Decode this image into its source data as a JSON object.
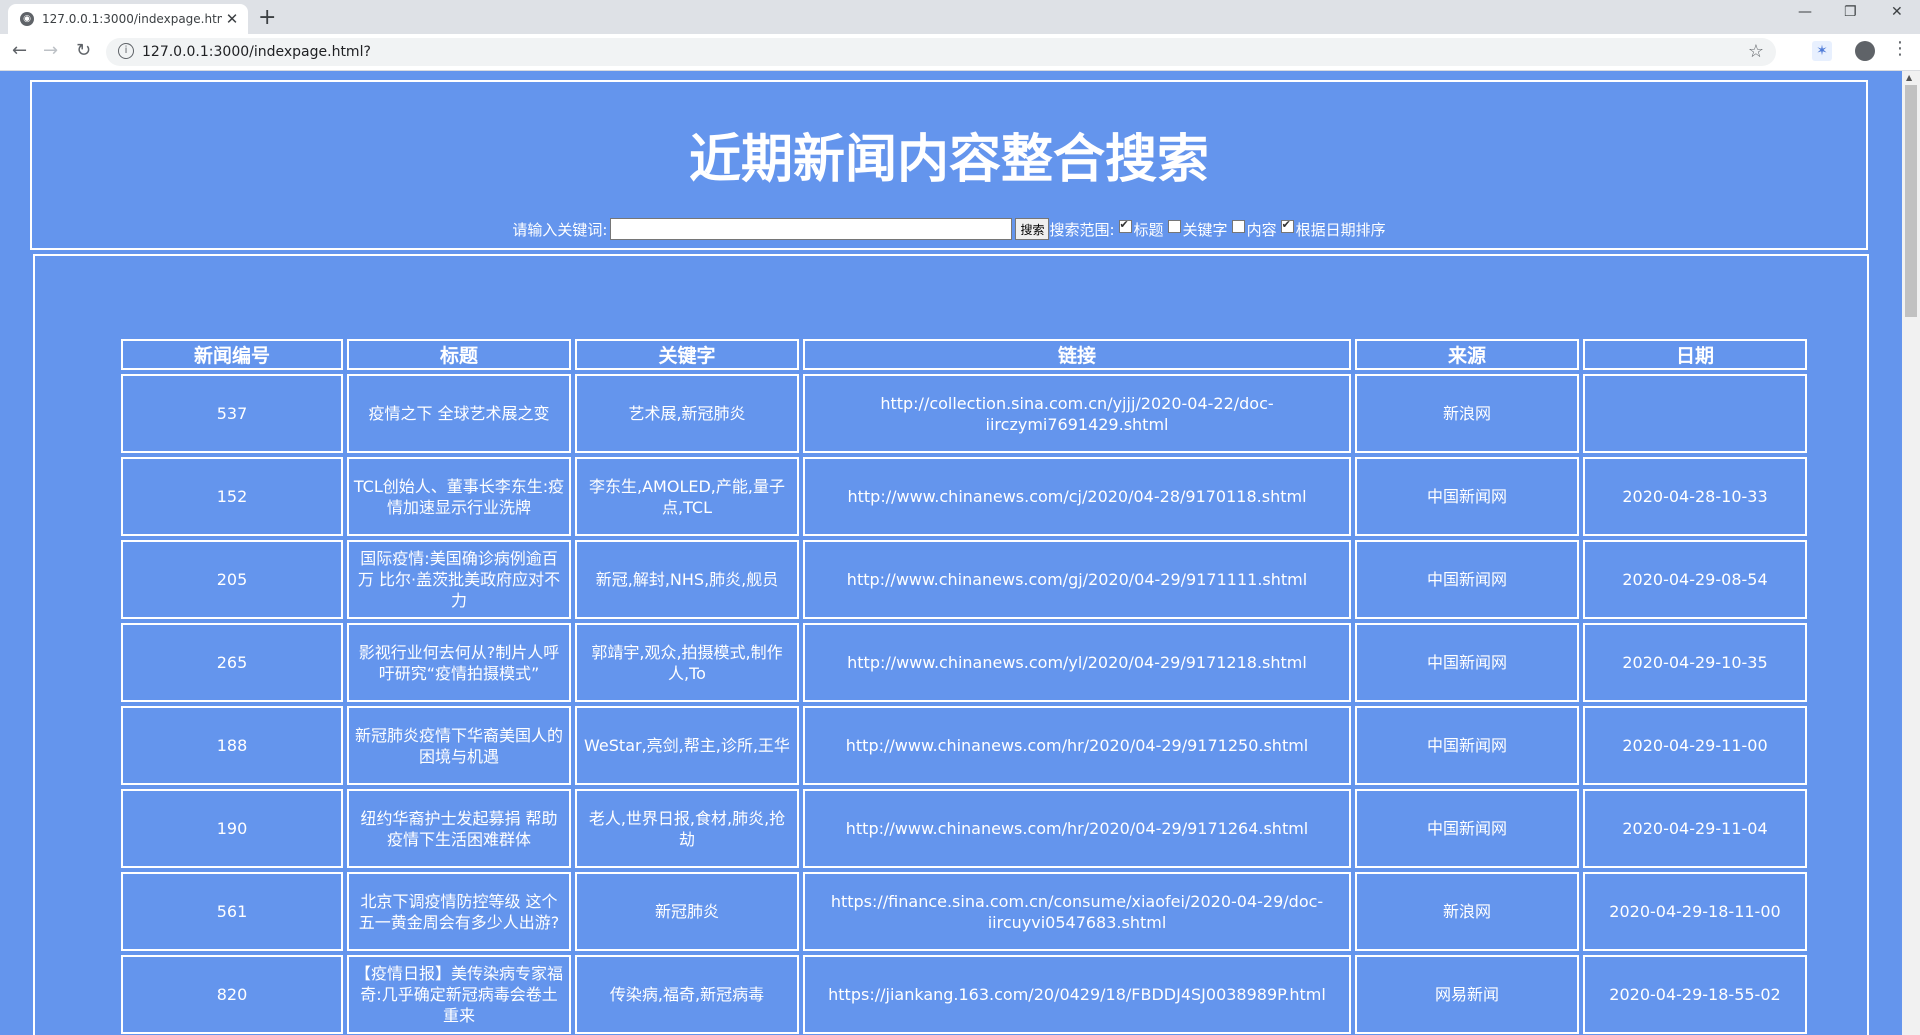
{
  "browser": {
    "tab_title": "127.0.0.1:3000/indexpage.htm",
    "url": "127.0.0.1:3000/indexpage.html?"
  },
  "page": {
    "title": "近期新闻内容整合搜索",
    "search_label": "请输入关键词:",
    "search_value": "",
    "search_button": "搜索",
    "scope_label": "搜索范围:",
    "options": [
      {
        "label": "标题",
        "checked": true
      },
      {
        "label": "关键字",
        "checked": false
      },
      {
        "label": "内容",
        "checked": false
      },
      {
        "label": "根据日期排序",
        "checked": true
      }
    ]
  },
  "table": {
    "headers": [
      "新闻编号",
      "标题",
      "关键字",
      "链接",
      "来源",
      "日期"
    ],
    "rows": [
      {
        "id": "537",
        "title": "疫情之下 全球艺术展之变",
        "keywords": "艺术展,新冠肺炎",
        "link": "http://collection.sina.com.cn/yjjj/2020-04-22/doc-iirczymi7691429.shtml",
        "source": "新浪网",
        "date": ""
      },
      {
        "id": "152",
        "title": "TCL创始人、董事长李东生:疫情加速显示行业洗牌",
        "keywords": "李东生,AMOLED,产能,量子点,TCL",
        "link": "http://www.chinanews.com/cj/2020/04-28/9170118.shtml",
        "source": "中国新闻网",
        "date": "2020-04-28-10-33"
      },
      {
        "id": "205",
        "title": "国际疫情:美国确诊病例逾百万 比尔·盖茨批美政府应对不力",
        "keywords": "新冠,解封,NHS,肺炎,舰员",
        "link": "http://www.chinanews.com/gj/2020/04-29/9171111.shtml",
        "source": "中国新闻网",
        "date": "2020-04-29-08-54"
      },
      {
        "id": "265",
        "title": "影视行业何去何从?制片人呼吁研究“疫情拍摄模式”",
        "keywords": "郭靖宇,观众,拍摄模式,制作人,To",
        "link": "http://www.chinanews.com/yl/2020/04-29/9171218.shtml",
        "source": "中国新闻网",
        "date": "2020-04-29-10-35"
      },
      {
        "id": "188",
        "title": "新冠肺炎疫情下华裔美国人的困境与机遇",
        "keywords": "WeStar,亮剑,帮主,诊所,王华",
        "link": "http://www.chinanews.com/hr/2020/04-29/9171250.shtml",
        "source": "中国新闻网",
        "date": "2020-04-29-11-00"
      },
      {
        "id": "190",
        "title": "纽约华裔护士发起募捐 帮助疫情下生活困难群体",
        "keywords": "老人,世界日报,食材,肺炎,抢劫",
        "link": "http://www.chinanews.com/hr/2020/04-29/9171264.shtml",
        "source": "中国新闻网",
        "date": "2020-04-29-11-04"
      },
      {
        "id": "561",
        "title": "北京下调疫情防控等级 这个五一黄金周会有多少人出游?",
        "keywords": "新冠肺炎",
        "link": "https://finance.sina.com.cn/consume/xiaofei/2020-04-29/doc-iircuyvi0547683.shtml",
        "source": "新浪网",
        "date": "2020-04-29-18-11-00"
      },
      {
        "id": "820",
        "title": "【疫情日报】美传染病专家福奇:几乎确定新冠病毒会卷土重来",
        "keywords": "传染病,福奇,新冠病毒",
        "link": "https://jiankang.163.com/20/0429/18/FBDDJ4SJ0038989P.html",
        "source": "网易新闻",
        "date": "2020-04-29-18-55-02"
      }
    ]
  }
}
